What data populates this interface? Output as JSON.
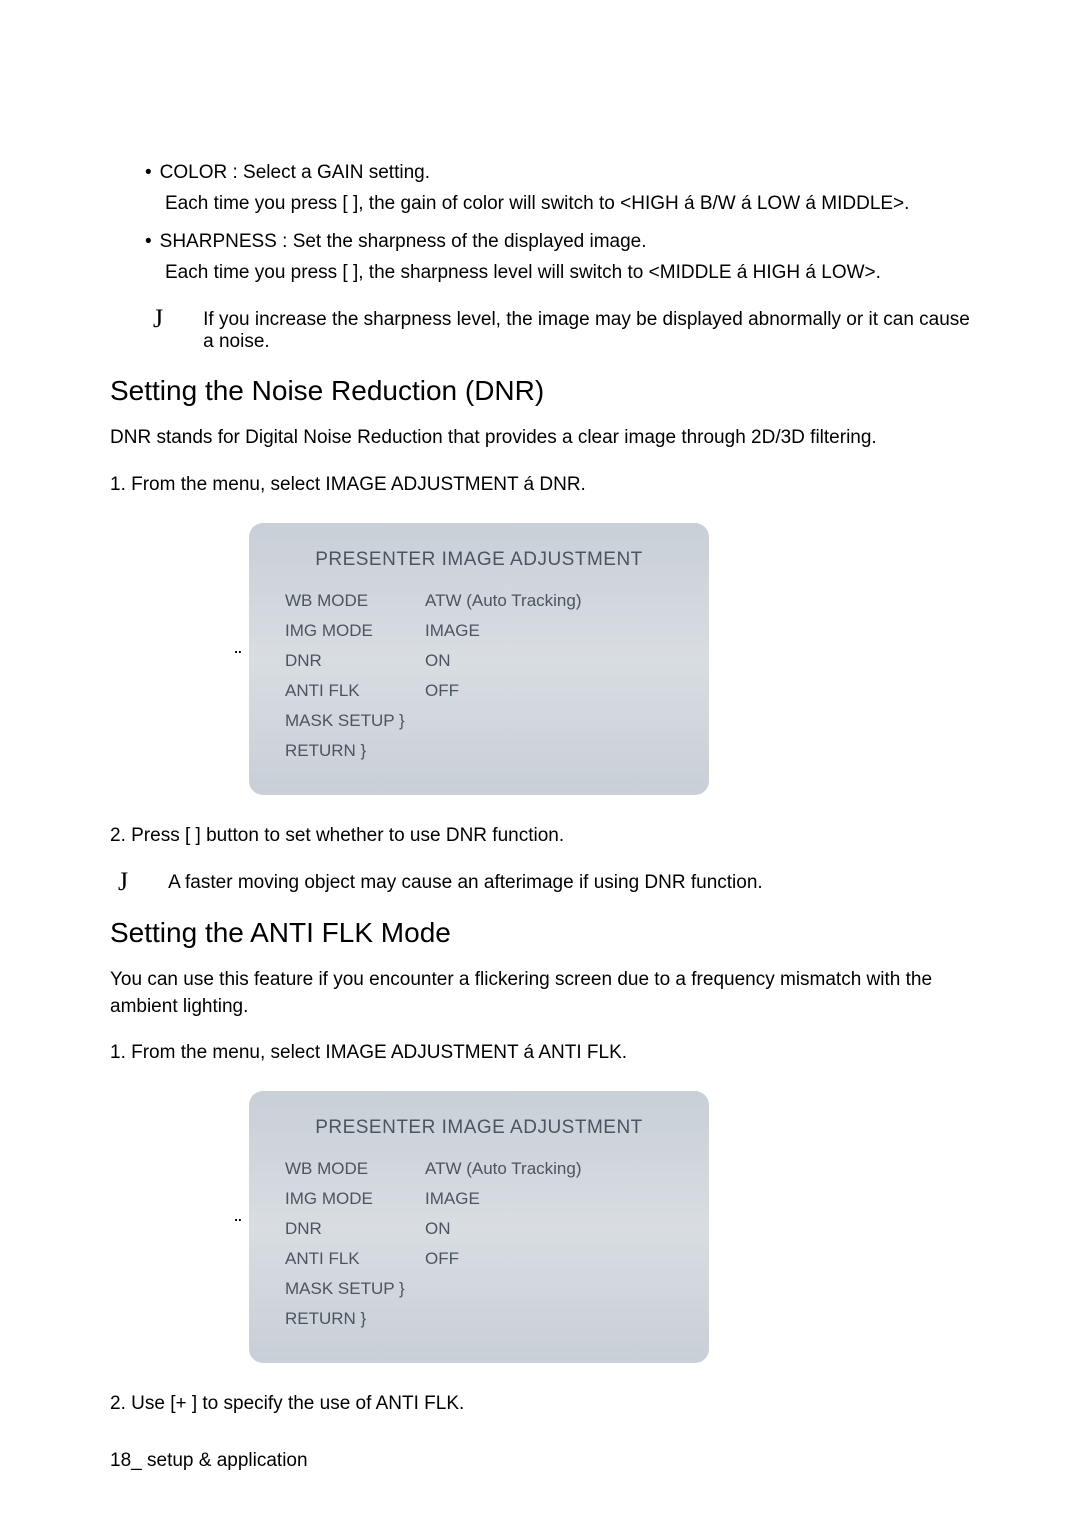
{
  "bullets": {
    "color_label": "COLOR : Select a GAIN setting.",
    "color_sub": "Each time you press [  ], the gain of color will switch to <HIGH á  B/W á  LOW á  MIDDLE>.",
    "sharpness_label": "SHARPNESS : Set the sharpness of the displayed image.",
    "sharpness_sub": "Each time you press [  ], the sharpness level will switch to <MIDDLE á  HIGH á  LOW>."
  },
  "note1_icon": "J",
  "note1_text": "If you increase the sharpness level, the image may be displayed abnormally or it can cause a noise.",
  "dnr": {
    "heading": "Setting the Noise Reduction (DNR)",
    "intro": "DNR stands for Digital Noise Reduction that provides a clear image through 2D/3D filtering.",
    "step1": "1.  From the menu, select IMAGE ADJUSTMENT á  DNR.",
    "step2": "2.  Press [ ] button to set whether to use DNR function.",
    "note_icon": "J",
    "note_text": "A faster moving object may cause an afterimage if using DNR function."
  },
  "antiflk": {
    "heading": "Setting the ANTI FLK Mode",
    "intro": "You can use this feature if you encounter a flickering screen due to a frequency mismatch with the ambient lighting.",
    "step1": "1.  From the menu, select IMAGE ADJUSTMENT á  ANTI FLK.",
    "step2": "2.  Use [+ ] to specify the use of ANTI FLK."
  },
  "menu": {
    "pointer": "¨",
    "title": "PRESENTER IMAGE ADJUSTMENT",
    "rows": [
      {
        "label": "WB MODE",
        "value": "ATW (Auto Tracking)"
      },
      {
        "label": "IMG MODE",
        "value": "IMAGE"
      },
      {
        "label": "DNR",
        "value": "ON"
      },
      {
        "label": "ANTI FLK",
        "value": "OFF"
      },
      {
        "label": "MASK SETUP  }",
        "value": ""
      },
      {
        "label": "RETURN  }",
        "value": ""
      }
    ]
  },
  "footer": {
    "page": "18",
    "separator": "_ ",
    "label": "setup & application"
  }
}
